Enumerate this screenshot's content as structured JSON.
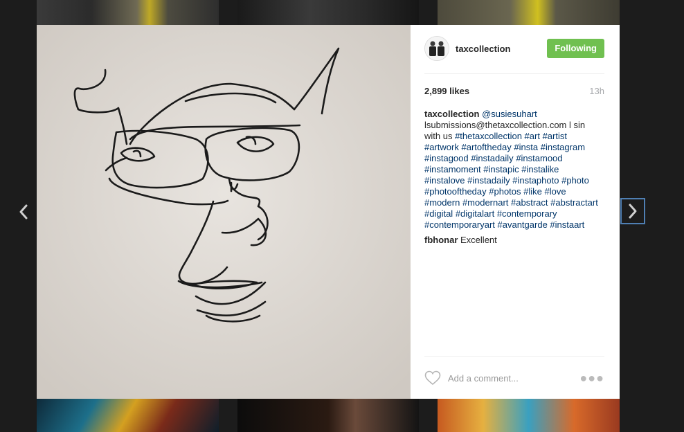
{
  "post": {
    "username": "taxcollection",
    "follow_label": "Following",
    "likes": "2,899 likes",
    "time": "13h"
  },
  "caption": {
    "username": "taxcollection",
    "parts": [
      {
        "text": "@susiesuhart",
        "link": true
      },
      {
        "text": " lsubmissions@thetaxcollection.com l sin with us ",
        "link": false
      },
      {
        "text": "#thetaxcollection",
        "link": true
      },
      {
        "text": " ",
        "link": false
      },
      {
        "text": "#art",
        "link": true
      },
      {
        "text": " ",
        "link": false
      },
      {
        "text": "#artist",
        "link": true
      },
      {
        "text": " ",
        "link": false
      },
      {
        "text": "#artwork",
        "link": true
      },
      {
        "text": " ",
        "link": false
      },
      {
        "text": "#artoftheday",
        "link": true
      },
      {
        "text": " ",
        "link": false
      },
      {
        "text": "#insta",
        "link": true
      },
      {
        "text": " ",
        "link": false
      },
      {
        "text": "#instagram",
        "link": true
      },
      {
        "text": " ",
        "link": false
      },
      {
        "text": "#instagood",
        "link": true
      },
      {
        "text": " ",
        "link": false
      },
      {
        "text": "#instadaily",
        "link": true
      },
      {
        "text": " ",
        "link": false
      },
      {
        "text": "#instamood",
        "link": true
      },
      {
        "text": " ",
        "link": false
      },
      {
        "text": "#instamoment",
        "link": true
      },
      {
        "text": " ",
        "link": false
      },
      {
        "text": "#instapic",
        "link": true
      },
      {
        "text": " ",
        "link": false
      },
      {
        "text": "#instalike",
        "link": true
      },
      {
        "text": " ",
        "link": false
      },
      {
        "text": "#instalove",
        "link": true
      },
      {
        "text": " ",
        "link": false
      },
      {
        "text": "#instadaily",
        "link": true
      },
      {
        "text": " ",
        "link": false
      },
      {
        "text": "#instaphoto",
        "link": true
      },
      {
        "text": " ",
        "link": false
      },
      {
        "text": "#photo",
        "link": true
      },
      {
        "text": " ",
        "link": false
      },
      {
        "text": "#photooftheday",
        "link": true
      },
      {
        "text": " ",
        "link": false
      },
      {
        "text": "#photos",
        "link": true
      },
      {
        "text": " ",
        "link": false
      },
      {
        "text": "#like",
        "link": true
      },
      {
        "text": " ",
        "link": false
      },
      {
        "text": "#love",
        "link": true
      },
      {
        "text": " ",
        "link": false
      },
      {
        "text": "#modern",
        "link": true
      },
      {
        "text": " ",
        "link": false
      },
      {
        "text": "#modernart",
        "link": true
      },
      {
        "text": " ",
        "link": false
      },
      {
        "text": "#abstract",
        "link": true
      },
      {
        "text": " ",
        "link": false
      },
      {
        "text": "#abstractart",
        "link": true
      },
      {
        "text": " ",
        "link": false
      },
      {
        "text": "#digital",
        "link": true
      },
      {
        "text": " ",
        "link": false
      },
      {
        "text": "#digitalart",
        "link": true
      },
      {
        "text": " ",
        "link": false
      },
      {
        "text": "#contemporary",
        "link": true
      },
      {
        "text": " ",
        "link": false
      },
      {
        "text": "#contemporaryart",
        "link": true
      },
      {
        "text": " ",
        "link": false
      },
      {
        "text": "#avantgarde",
        "link": true
      },
      {
        "text": " ",
        "link": false
      },
      {
        "text": "#instaart",
        "link": true
      }
    ]
  },
  "comments": [
    {
      "username": "fbhonar",
      "text": "Excellent"
    }
  ],
  "footer": {
    "add_comment_placeholder": "Add a comment..."
  },
  "icons": {
    "prev": "chevron-left-icon",
    "next": "chevron-right-icon",
    "like": "heart-icon",
    "more": "more-options-icon"
  },
  "colors": {
    "follow_button": "#70c050",
    "link": "#003569",
    "overlay": "#1c1c1c"
  }
}
